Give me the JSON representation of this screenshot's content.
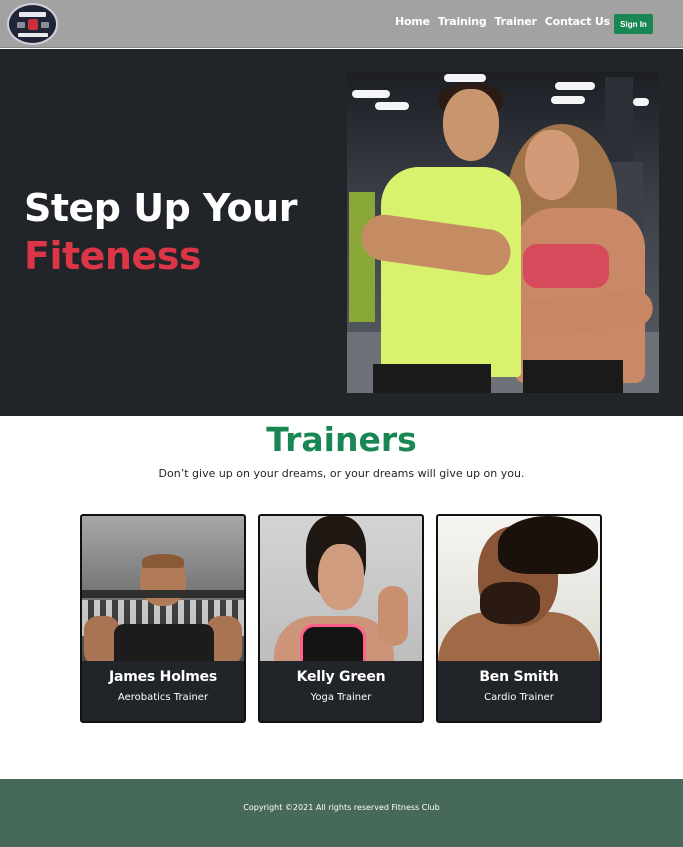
{
  "colors": {
    "navbar_bg": "#a2a2a2",
    "hero_bg": "#212529",
    "accent_red": "#dc3545",
    "brand_green": "#198754",
    "footer_bg": "#46695a"
  },
  "navbar": {
    "logo_icon": "fitness-club-logo",
    "links": [
      "Home",
      "Training",
      "Trainer",
      "Contact Us"
    ],
    "signin_label": "Sign In"
  },
  "hero": {
    "title_line1": "Step Up Your",
    "title_line2": "Fiteness",
    "image": "hero-couple-photo"
  },
  "trainers": {
    "title": "Trainers",
    "subtitle": "Don’t give up on your dreams, or your dreams will give up on you.",
    "cards": [
      {
        "name": "James Holmes",
        "role": "Aerobatics Trainer",
        "image": "trainer-photo-james"
      },
      {
        "name": "Kelly Green",
        "role": "Yoga Trainer",
        "image": "trainer-photo-kelly"
      },
      {
        "name": "Ben Smith",
        "role": "Cardio Trainer",
        "image": "trainer-photo-ben"
      }
    ]
  },
  "footer": {
    "copyright": "Copyright ©2021 All rights reserved Fitness Club"
  }
}
